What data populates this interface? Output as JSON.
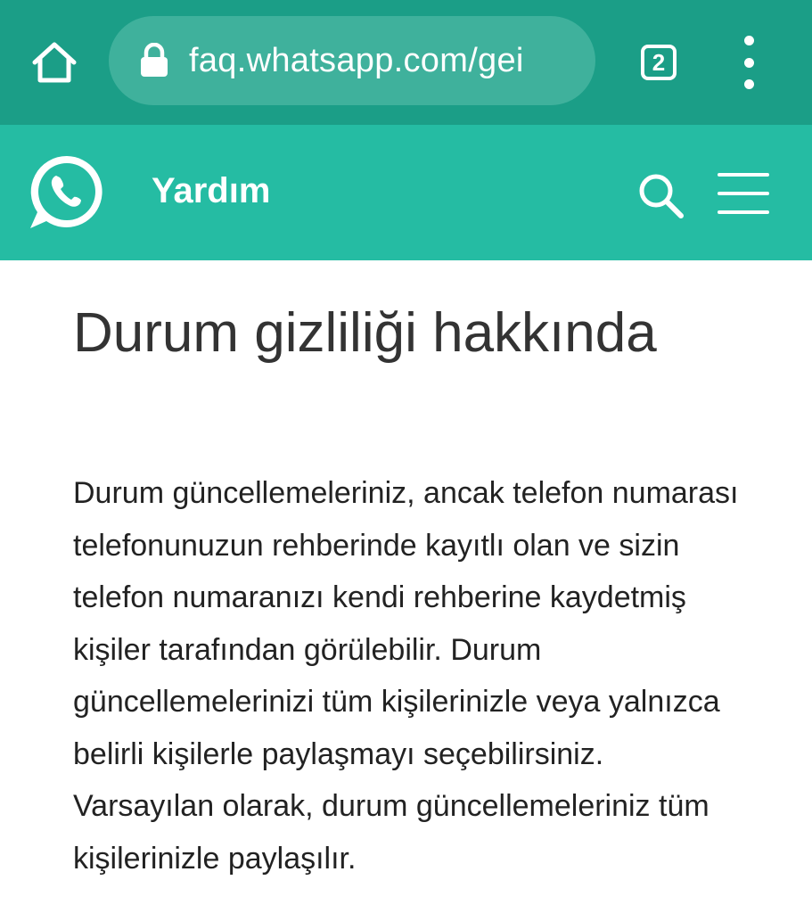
{
  "browser": {
    "url": "faq.whatsapp.com/gei",
    "tab_count": "2",
    "colors": {
      "toolbar": "#1b9e87",
      "url_box": "#3fb19c"
    },
    "icons": [
      "home-icon",
      "lock-icon",
      "tabs-icon",
      "overflow-menu-icon"
    ]
  },
  "site_header": {
    "title": "Yardım",
    "color": "#25bca3",
    "icons": [
      "whatsapp-logo",
      "search-icon",
      "hamburger-menu-icon"
    ]
  },
  "article": {
    "title": "Durum gizliliği hakkında",
    "body": "Durum güncellemeleriniz, ancak telefon numarası telefonunuzun rehberinde kayıtlı olan ve sizin telefon numaranızı kendi rehberine kaydetmiş kişiler tarafından görülebilir. Durum güncellemelerinizi tüm kişilerinizle veya yalnızca belirli kişilerle paylaşmayı seçebilirsiniz. Varsayılan olarak, durum güncellemeleriniz tüm kişilerinizle paylaşılır."
  }
}
